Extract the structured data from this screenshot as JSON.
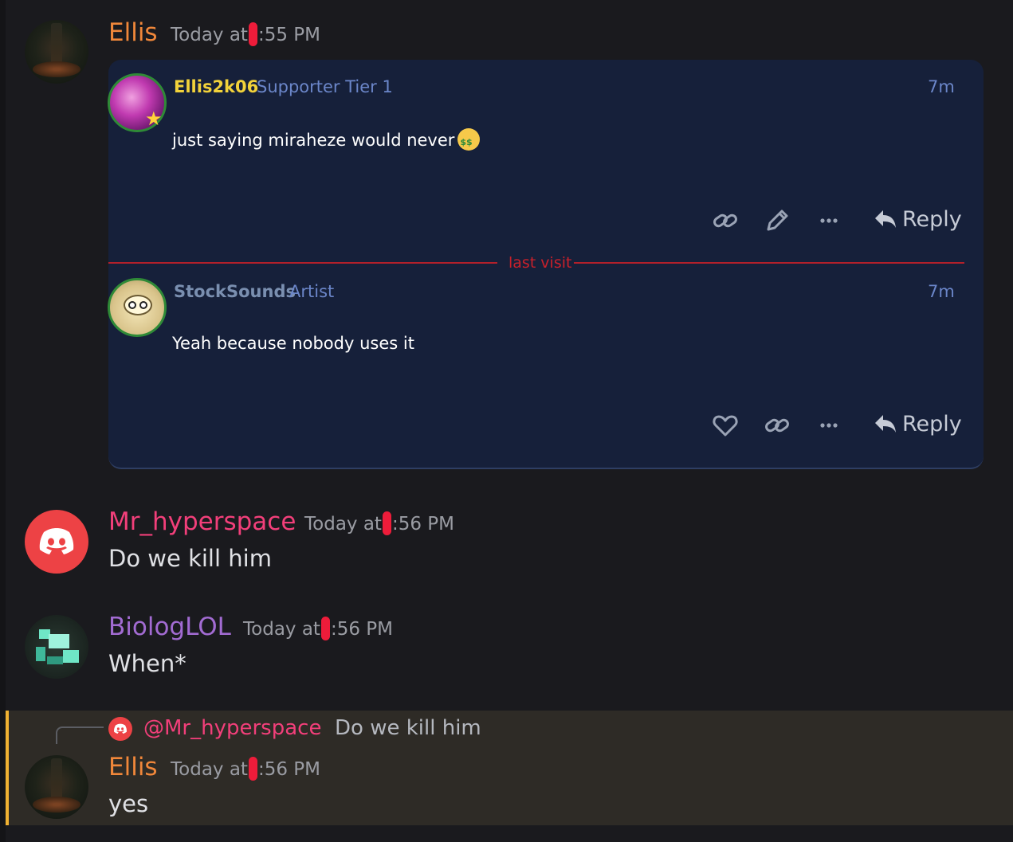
{
  "messages": [
    {
      "author": "Ellis",
      "author_color": "#f0873a",
      "time_prefix": "Today at",
      "time_suffix": ":55 PM",
      "avatar": "tree-avatar"
    },
    {
      "author": "Mr_hyperspace",
      "author_color": "#f23f7a",
      "time_prefix": "Today at",
      "time_suffix": ":56 PM",
      "text": "Do we kill him",
      "avatar": "discord-logo-icon"
    },
    {
      "author": "BiologLOL",
      "author_color": "#a26bd2",
      "time_prefix": "Today at",
      "time_suffix": ":56 PM",
      "text": "When*",
      "avatar": "pixel-avatar"
    },
    {
      "author": "Ellis",
      "author_color": "#f0873a",
      "time_prefix": "Today at",
      "time_suffix": ":56 PM",
      "text": "yes",
      "avatar": "tree-avatar",
      "reply_to": {
        "name": "@Mr_hyperspace",
        "text": "Do we kill him"
      }
    }
  ],
  "embed": {
    "posts": [
      {
        "user": "Ellis2k06",
        "user_color": "#f2d23a",
        "role": "Supporter Tier 1",
        "time": "7m",
        "text": "just saying miraheze would never",
        "emoji": "money-mouth-emoji",
        "actions": [
          "link-icon",
          "edit-icon",
          "more-icon"
        ],
        "reply_label": "Reply"
      },
      {
        "user": "StockSounds",
        "user_color": "#7a8fb0",
        "role": "Artist",
        "time": "7m",
        "text": "Yeah because nobody uses it",
        "actions": [
          "heart-icon",
          "link-icon",
          "more-icon"
        ],
        "reply_label": "Reply"
      }
    ],
    "divider_label": "last visit"
  },
  "colors": {
    "background": "#1a1a1e",
    "embed_background": "#16203a",
    "highlight_background": "#2e2b26",
    "highlight_accent": "#f0b132",
    "divider": "#b3202a"
  }
}
